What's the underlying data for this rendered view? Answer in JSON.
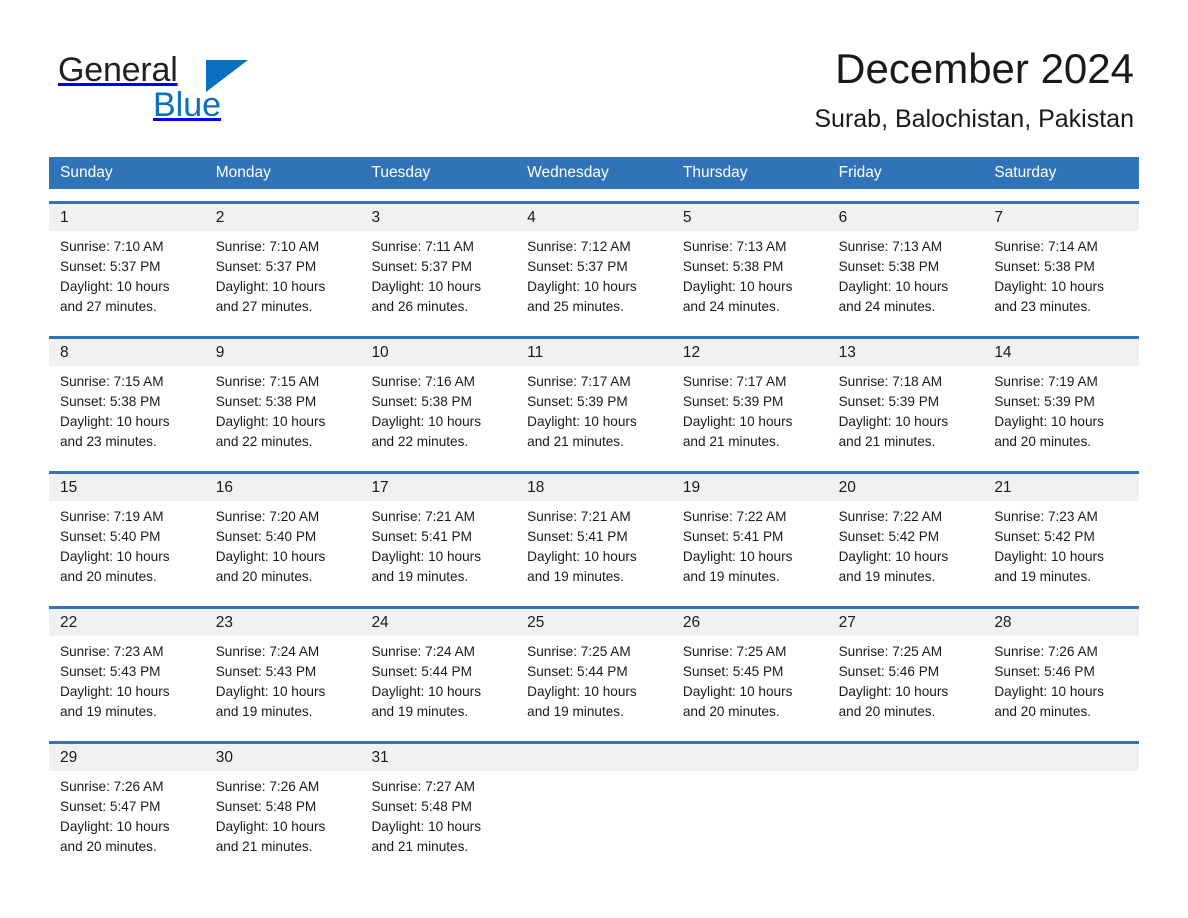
{
  "brand": {
    "name_part1": "General",
    "name_part2": "Blue",
    "triangle_icon": "triangle-icon",
    "accent_color": "#0a70c0"
  },
  "header": {
    "title": "December 2024",
    "location": "Surab, Balochistan, Pakistan"
  },
  "colors": {
    "header_blue": "#3173b8",
    "daynum_band": "#f1f1f1",
    "text": "#1a1a1a",
    "white": "#ffffff"
  },
  "weekdays": [
    "Sunday",
    "Monday",
    "Tuesday",
    "Wednesday",
    "Thursday",
    "Friday",
    "Saturday"
  ],
  "labels": {
    "sunrise_prefix": "Sunrise: ",
    "sunset_prefix": "Sunset: ",
    "daylight_prefix": "Daylight: "
  },
  "weeks": [
    [
      {
        "day": "1",
        "sunrise": "Sunrise: 7:10 AM",
        "sunset": "Sunset: 5:37 PM",
        "daylight": "Daylight: 10 hours and 27 minutes."
      },
      {
        "day": "2",
        "sunrise": "Sunrise: 7:10 AM",
        "sunset": "Sunset: 5:37 PM",
        "daylight": "Daylight: 10 hours and 27 minutes."
      },
      {
        "day": "3",
        "sunrise": "Sunrise: 7:11 AM",
        "sunset": "Sunset: 5:37 PM",
        "daylight": "Daylight: 10 hours and 26 minutes."
      },
      {
        "day": "4",
        "sunrise": "Sunrise: 7:12 AM",
        "sunset": "Sunset: 5:37 PM",
        "daylight": "Daylight: 10 hours and 25 minutes."
      },
      {
        "day": "5",
        "sunrise": "Sunrise: 7:13 AM",
        "sunset": "Sunset: 5:38 PM",
        "daylight": "Daylight: 10 hours and 24 minutes."
      },
      {
        "day": "6",
        "sunrise": "Sunrise: 7:13 AM",
        "sunset": "Sunset: 5:38 PM",
        "daylight": "Daylight: 10 hours and 24 minutes."
      },
      {
        "day": "7",
        "sunrise": "Sunrise: 7:14 AM",
        "sunset": "Sunset: 5:38 PM",
        "daylight": "Daylight: 10 hours and 23 minutes."
      }
    ],
    [
      {
        "day": "8",
        "sunrise": "Sunrise: 7:15 AM",
        "sunset": "Sunset: 5:38 PM",
        "daylight": "Daylight: 10 hours and 23 minutes."
      },
      {
        "day": "9",
        "sunrise": "Sunrise: 7:15 AM",
        "sunset": "Sunset: 5:38 PM",
        "daylight": "Daylight: 10 hours and 22 minutes."
      },
      {
        "day": "10",
        "sunrise": "Sunrise: 7:16 AM",
        "sunset": "Sunset: 5:38 PM",
        "daylight": "Daylight: 10 hours and 22 minutes."
      },
      {
        "day": "11",
        "sunrise": "Sunrise: 7:17 AM",
        "sunset": "Sunset: 5:39 PM",
        "daylight": "Daylight: 10 hours and 21 minutes."
      },
      {
        "day": "12",
        "sunrise": "Sunrise: 7:17 AM",
        "sunset": "Sunset: 5:39 PM",
        "daylight": "Daylight: 10 hours and 21 minutes."
      },
      {
        "day": "13",
        "sunrise": "Sunrise: 7:18 AM",
        "sunset": "Sunset: 5:39 PM",
        "daylight": "Daylight: 10 hours and 21 minutes."
      },
      {
        "day": "14",
        "sunrise": "Sunrise: 7:19 AM",
        "sunset": "Sunset: 5:39 PM",
        "daylight": "Daylight: 10 hours and 20 minutes."
      }
    ],
    [
      {
        "day": "15",
        "sunrise": "Sunrise: 7:19 AM",
        "sunset": "Sunset: 5:40 PM",
        "daylight": "Daylight: 10 hours and 20 minutes."
      },
      {
        "day": "16",
        "sunrise": "Sunrise: 7:20 AM",
        "sunset": "Sunset: 5:40 PM",
        "daylight": "Daylight: 10 hours and 20 minutes."
      },
      {
        "day": "17",
        "sunrise": "Sunrise: 7:21 AM",
        "sunset": "Sunset: 5:41 PM",
        "daylight": "Daylight: 10 hours and 19 minutes."
      },
      {
        "day": "18",
        "sunrise": "Sunrise: 7:21 AM",
        "sunset": "Sunset: 5:41 PM",
        "daylight": "Daylight: 10 hours and 19 minutes."
      },
      {
        "day": "19",
        "sunrise": "Sunrise: 7:22 AM",
        "sunset": "Sunset: 5:41 PM",
        "daylight": "Daylight: 10 hours and 19 minutes."
      },
      {
        "day": "20",
        "sunrise": "Sunrise: 7:22 AM",
        "sunset": "Sunset: 5:42 PM",
        "daylight": "Daylight: 10 hours and 19 minutes."
      },
      {
        "day": "21",
        "sunrise": "Sunrise: 7:23 AM",
        "sunset": "Sunset: 5:42 PM",
        "daylight": "Daylight: 10 hours and 19 minutes."
      }
    ],
    [
      {
        "day": "22",
        "sunrise": "Sunrise: 7:23 AM",
        "sunset": "Sunset: 5:43 PM",
        "daylight": "Daylight: 10 hours and 19 minutes."
      },
      {
        "day": "23",
        "sunrise": "Sunrise: 7:24 AM",
        "sunset": "Sunset: 5:43 PM",
        "daylight": "Daylight: 10 hours and 19 minutes."
      },
      {
        "day": "24",
        "sunrise": "Sunrise: 7:24 AM",
        "sunset": "Sunset: 5:44 PM",
        "daylight": "Daylight: 10 hours and 19 minutes."
      },
      {
        "day": "25",
        "sunrise": "Sunrise: 7:25 AM",
        "sunset": "Sunset: 5:44 PM",
        "daylight": "Daylight: 10 hours and 19 minutes."
      },
      {
        "day": "26",
        "sunrise": "Sunrise: 7:25 AM",
        "sunset": "Sunset: 5:45 PM",
        "daylight": "Daylight: 10 hours and 20 minutes."
      },
      {
        "day": "27",
        "sunrise": "Sunrise: 7:25 AM",
        "sunset": "Sunset: 5:46 PM",
        "daylight": "Daylight: 10 hours and 20 minutes."
      },
      {
        "day": "28",
        "sunrise": "Sunrise: 7:26 AM",
        "sunset": "Sunset: 5:46 PM",
        "daylight": "Daylight: 10 hours and 20 minutes."
      }
    ],
    [
      {
        "day": "29",
        "sunrise": "Sunrise: 7:26 AM",
        "sunset": "Sunset: 5:47 PM",
        "daylight": "Daylight: 10 hours and 20 minutes."
      },
      {
        "day": "30",
        "sunrise": "Sunrise: 7:26 AM",
        "sunset": "Sunset: 5:48 PM",
        "daylight": "Daylight: 10 hours and 21 minutes."
      },
      {
        "day": "31",
        "sunrise": "Sunrise: 7:27 AM",
        "sunset": "Sunset: 5:48 PM",
        "daylight": "Daylight: 10 hours and 21 minutes."
      },
      {
        "day": "",
        "sunrise": "",
        "sunset": "",
        "daylight": ""
      },
      {
        "day": "",
        "sunrise": "",
        "sunset": "",
        "daylight": ""
      },
      {
        "day": "",
        "sunrise": "",
        "sunset": "",
        "daylight": ""
      },
      {
        "day": "",
        "sunrise": "",
        "sunset": "",
        "daylight": ""
      }
    ]
  ]
}
